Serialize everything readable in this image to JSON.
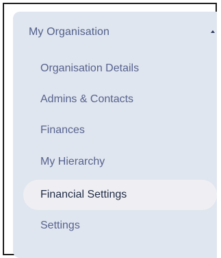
{
  "sidebar": {
    "section_title": "My Organisation",
    "expanded": true,
    "items": [
      {
        "label": "Organisation Details",
        "active": false
      },
      {
        "label": "Admins & Contacts",
        "active": false
      },
      {
        "label": "Finances",
        "active": false
      },
      {
        "label": "My Hierarchy",
        "active": false
      },
      {
        "label": "Financial Settings",
        "active": true
      },
      {
        "label": "Settings",
        "active": false
      }
    ]
  },
  "colors": {
    "panel_bg": "#e0e6ef",
    "item_text": "#56628e",
    "active_bg": "#efeff3",
    "active_text": "#1f2a44",
    "border": "#1c1c1c"
  },
  "icons": {
    "collapse": "caret-up-icon"
  }
}
